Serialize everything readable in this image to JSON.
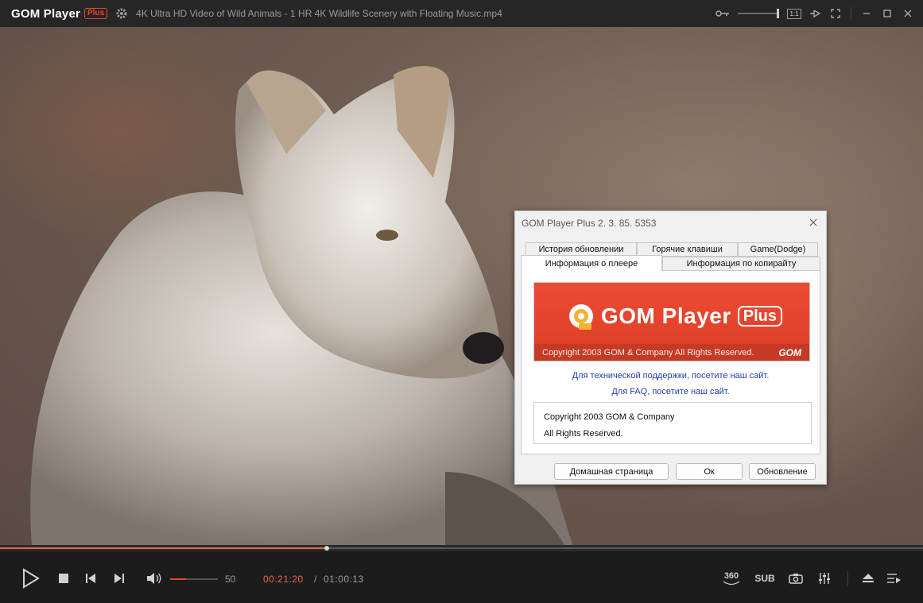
{
  "titlebar": {
    "app_name": "GOM Player",
    "app_badge": "Plus",
    "file_title": "4K Ultra HD Video of Wild Animals - 1 HR 4K Wildlife Scenery with Floating Music.mp4",
    "ratio_label": "1:1",
    "icons": [
      "settings-gear-icon",
      "key-icon",
      "ratio-icon",
      "pin-icon",
      "fullscreen-icon",
      "minimize-icon",
      "maximize-icon",
      "close-icon"
    ]
  },
  "dialog": {
    "title": "GOM Player Plus 2. 3. 85. 5353",
    "tabs_back": [
      "История обновлении",
      "Горячие клавиши",
      "Game(Dodge)"
    ],
    "tabs_front": [
      "Информация о плеере",
      "Информация по копирайту"
    ],
    "active_tab": "Информация о плеере",
    "banner": {
      "name": "GOM Player",
      "badge": "Plus",
      "copyright": "Copyright 2003 GOM & Company All Rights Reserved.",
      "brand": "GOM",
      "accent": "#e8452c"
    },
    "support_link": "Для технической поддержки, посетите наш сайт.",
    "faq_link": "Для FAQ, посетите наш сайт.",
    "copyright_lines": [
      "Copyright 2003 GOM & Company",
      "All Rights Reserved."
    ],
    "buttons": {
      "homepage": "Домашная страница",
      "ok": "Ок",
      "update": "Обновление"
    }
  },
  "player": {
    "seek_progress_fraction": 0.354,
    "volume": "50",
    "volume_fraction": 0.33,
    "current_time": "00:21:20",
    "time_separator": "/",
    "total_time": "01:00:13",
    "btn_360": "360",
    "btn_sub": "SUB",
    "accent_color": "#e8684a"
  }
}
